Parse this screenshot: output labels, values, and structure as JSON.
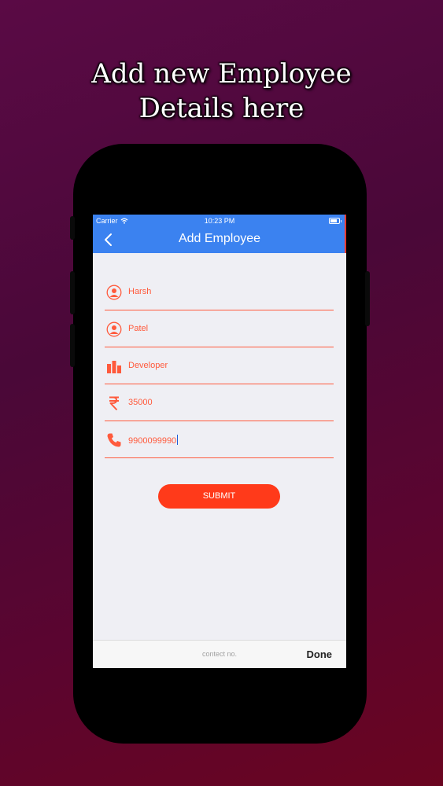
{
  "promo": {
    "line1": "Add new Employee",
    "line2": "Details here"
  },
  "status_bar": {
    "carrier": "Carrier",
    "time": "10:23 PM"
  },
  "navbar": {
    "title": "Add Employee"
  },
  "form": {
    "first_name": "Harsh",
    "last_name": "Patel",
    "designation": "Developer",
    "salary": "35000",
    "contact": "9900099990"
  },
  "submit_label": "SUBMIT",
  "keyboard_toolbar": {
    "hint": "contect no.",
    "done_label": "Done"
  },
  "colors": {
    "navbar": "#3b82f0",
    "accent": "#ff5a3c",
    "submit": "#ff3a1a"
  }
}
